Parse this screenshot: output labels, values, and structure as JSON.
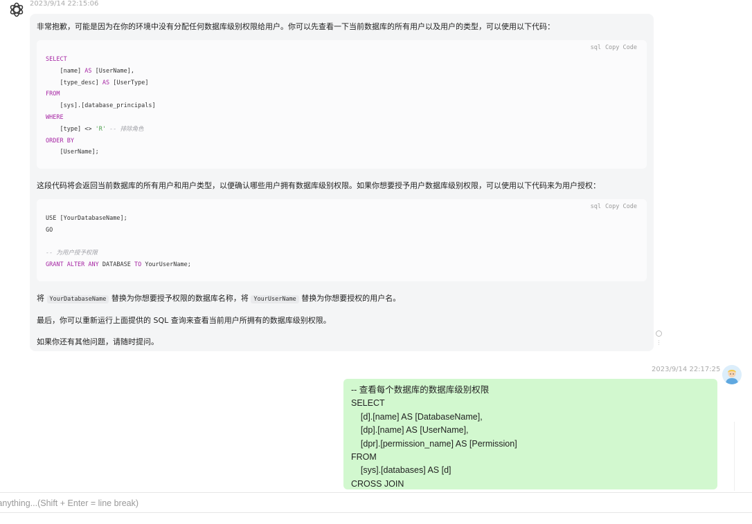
{
  "assistant": {
    "timestamp": "2023/9/14 22:15:06",
    "intro": "非常抱歉，可能是因为在你的环境中没有分配任何数据库级别权限给用户。你可以先查看一下当前数据库的所有用户以及用户的类型，可以使用以下代码：",
    "code1": {
      "lang": "sql",
      "copy_label": "Copy Code",
      "lines": [
        [
          {
            "t": "SELECT",
            "c": "kw"
          }
        ],
        [
          {
            "t": "    [name] "
          },
          {
            "t": "AS",
            "c": "kw"
          },
          {
            "t": " [UserName],"
          }
        ],
        [
          {
            "t": "    [type_desc] "
          },
          {
            "t": "AS",
            "c": "kw"
          },
          {
            "t": " [UserType]"
          }
        ],
        [
          {
            "t": "FROM",
            "c": "kw"
          }
        ],
        [
          {
            "t": "    [sys].[database_principals]"
          }
        ],
        [
          {
            "t": "WHERE",
            "c": "kw"
          }
        ],
        [
          {
            "t": "    [type] <> "
          },
          {
            "t": "'R'",
            "c": "str"
          },
          {
            "t": " "
          },
          {
            "t": "-- 排除角色",
            "c": "cmt"
          }
        ],
        [
          {
            "t": "ORDER BY",
            "c": "kw"
          }
        ],
        [
          {
            "t": "    [UserName];"
          }
        ]
      ]
    },
    "middle": "这段代码将会返回当前数据库的所有用户和用户类型，以便确认哪些用户拥有数据库级别权限。如果你想要授予用户数据库级别权限，可以使用以下代码来为用户授权：",
    "code2": {
      "lang": "sql",
      "copy_label": "Copy Code",
      "lines": [
        [
          {
            "t": "USE [YourDatabaseName];"
          }
        ],
        [
          {
            "t": "GO"
          }
        ],
        [
          {
            "t": ""
          }
        ],
        [
          {
            "t": "-- 为用户授予权限",
            "c": "cmt"
          }
        ],
        [
          {
            "t": "GRANT ALTER ANY",
            "c": "kw"
          },
          {
            "t": " DATABASE "
          },
          {
            "t": "TO",
            "c": "kw"
          },
          {
            "t": " YourUserName;"
          }
        ]
      ]
    },
    "replace": {
      "prefix": "将 ",
      "code_a": "YourDatabaseName",
      "mid": " 替换为你想要授予权限的数据库名称，将 ",
      "code_b": "YourUserName",
      "suffix": " 替换为你想要授权的用户名。"
    },
    "finally": "最后，你可以重新运行上面提供的 SQL 查询来查看当前用户所拥有的数据库级别权限。",
    "closing": "如果你还有其他问题，请随时提问。"
  },
  "user": {
    "timestamp": "2023/9/14 22:17:25",
    "lines": [
      "-- 查看每个数据库的数据库级别权限",
      "SELECT",
      "    [d].[name] AS [DatabaseName],",
      "    [dp].[name] AS [UserName],",
      "    [dpr].[permission_name] AS [Permission]",
      "FROM",
      "    [sys].[databases] AS [d]",
      "CROSS JOIN"
    ]
  },
  "input": {
    "placeholder": "e anything...(Shift + Enter = line break)"
  }
}
